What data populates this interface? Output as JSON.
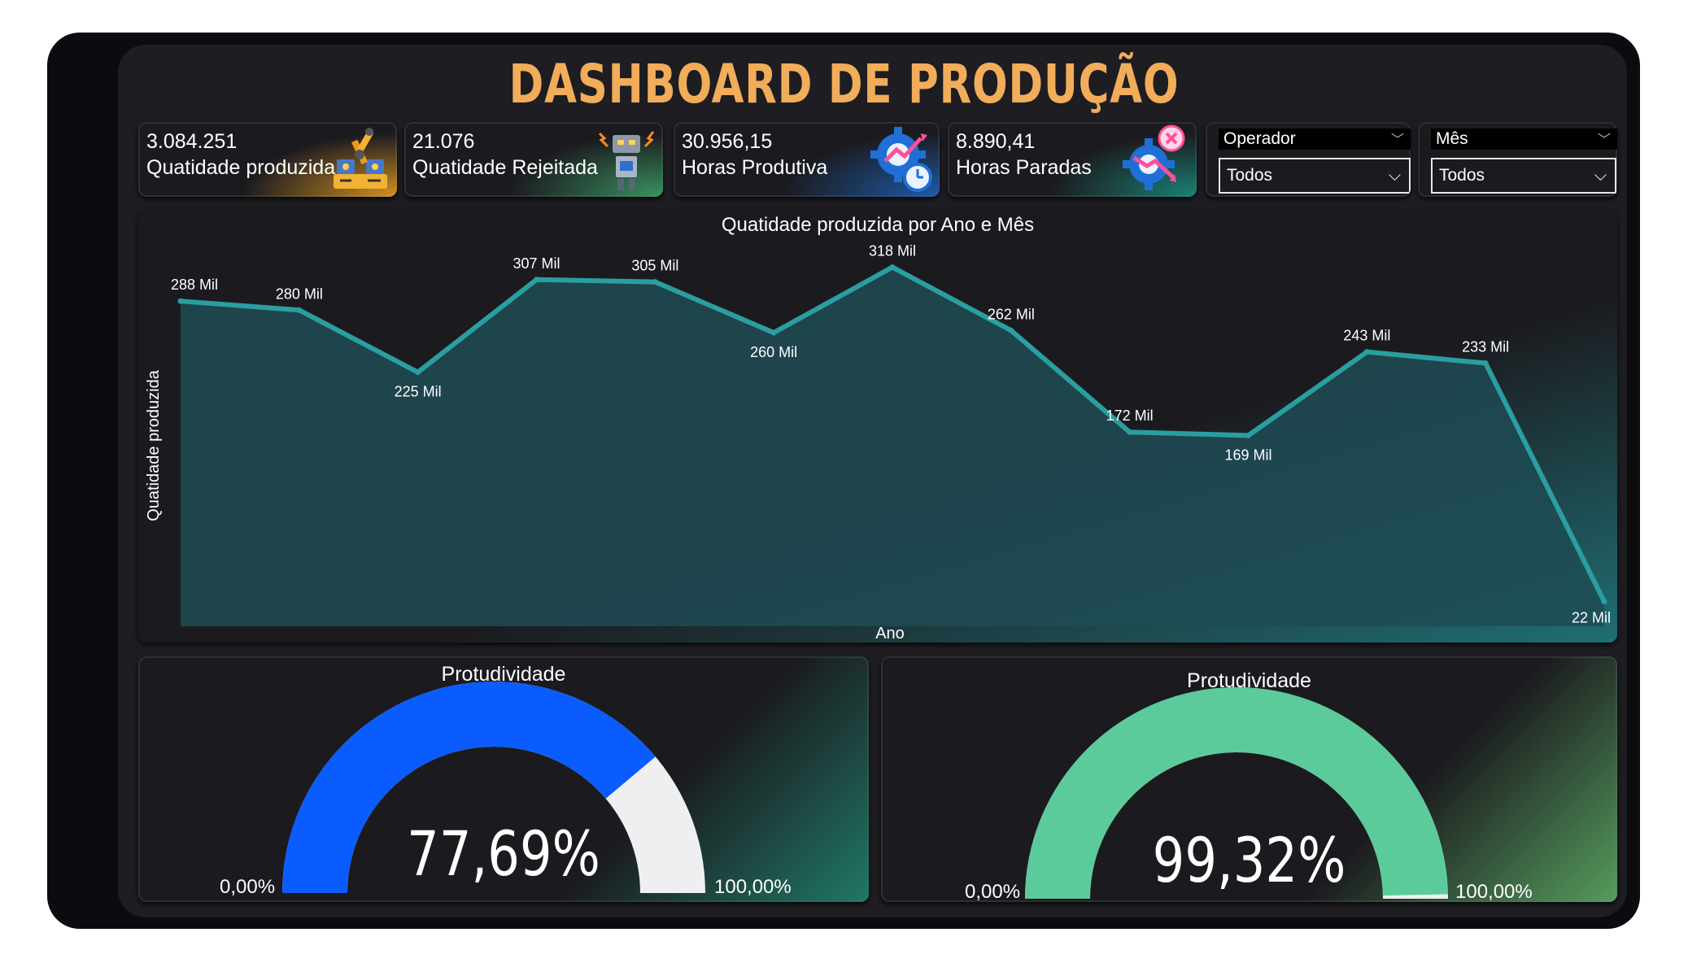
{
  "title": "DASHBOARD DE PRODUÇÃO",
  "kpis": [
    {
      "value": "3.084.251",
      "label": "Quatidade produzida",
      "icon": "factory-robot-arm-icon",
      "accent": "#f5a623"
    },
    {
      "value": "21.076",
      "label": "Quatidade Rejeitada",
      "icon": "broken-robot-icon",
      "accent": "#3fa76b"
    },
    {
      "value": "30.956,15",
      "label": "Horas Produtiva",
      "icon": "gear-growth-clock-icon",
      "accent": "#1f6fd6"
    },
    {
      "value": "8.890,41",
      "label": "Horas Paradas",
      "icon": "gear-decline-stop-icon",
      "accent": "#1a9c8a"
    }
  ],
  "slicers": [
    {
      "label": "Operador",
      "selected": "Todos"
    },
    {
      "label": "Mês",
      "selected": "Todos"
    }
  ],
  "chart_data": {
    "type": "area",
    "title": "Quatidade produzida por Ano e Mês",
    "xlabel": "Ano",
    "ylabel": "Quatidade produzida",
    "values": [
      288000,
      280000,
      225000,
      307000,
      305000,
      260000,
      318000,
      262000,
      172000,
      169000,
      243000,
      233000,
      22000
    ],
    "data_labels": [
      "288 Mil",
      "280 Mil",
      "225 Mil",
      "307 Mil",
      "305 Mil",
      "260 Mil",
      "318 Mil",
      "262 Mil",
      "172 Mil",
      "169 Mil",
      "243 Mil",
      "233 Mil",
      "22 Mil"
    ],
    "ylim": [
      0,
      340000
    ],
    "line_color": "#2a9ea0",
    "fill_color": "#1e4b55",
    "grid": false
  },
  "gauges": [
    {
      "title": "Protudividade",
      "value_label": "77,69%",
      "fraction": 0.7769,
      "min_label": "0,00%",
      "max_label": "100,00%",
      "fill_color": "#0a5cff",
      "track_color": "#efeff1"
    },
    {
      "title": "Protudividade",
      "value_label": "99,32%",
      "fraction": 0.9932,
      "min_label": "0,00%",
      "max_label": "100,00%",
      "fill_color": "#5ccb9c",
      "track_color": "#efeff1"
    }
  ]
}
